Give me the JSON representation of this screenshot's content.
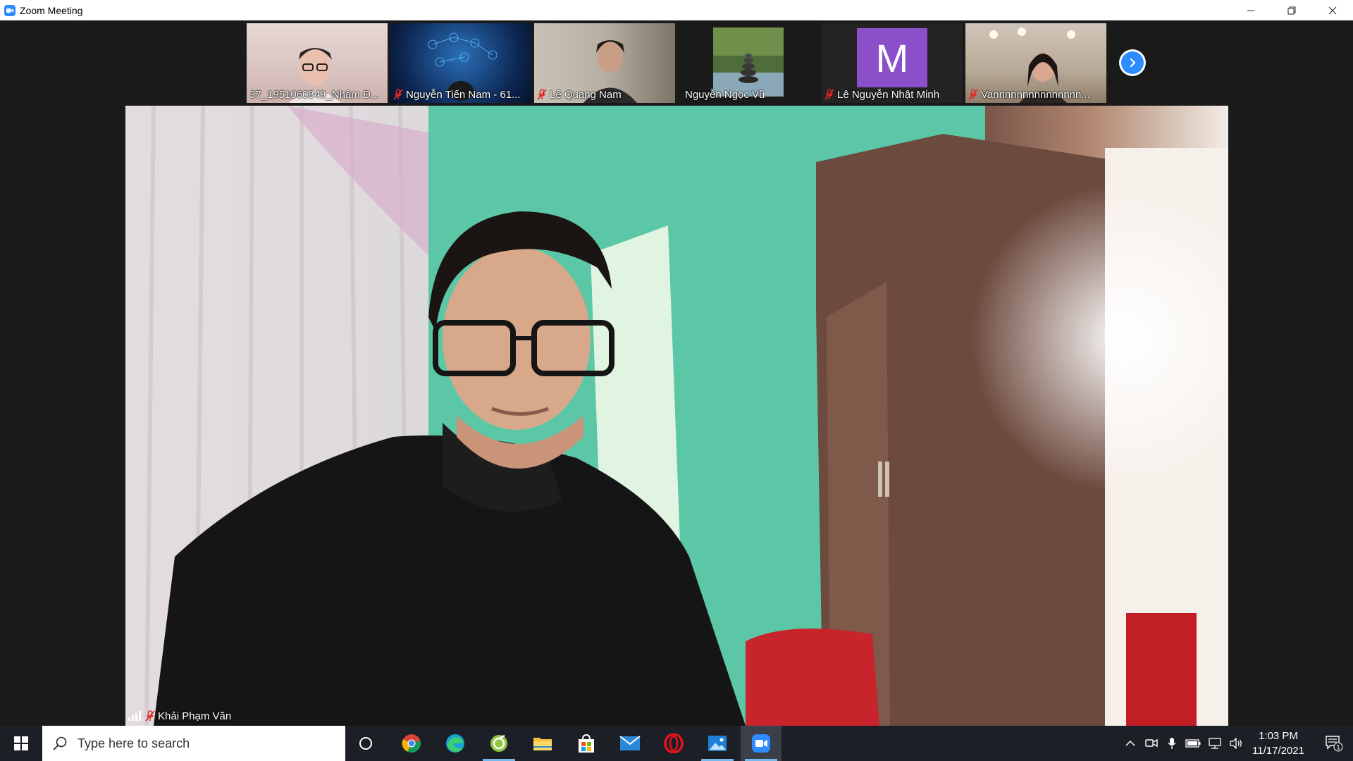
{
  "window": {
    "title": "Zoom Meeting",
    "controls": [
      "minimize-icon",
      "restore-icon",
      "close-icon"
    ]
  },
  "gallery": {
    "participants": [
      {
        "name": "37_1951060849_Nhâm Đ...",
        "muted": false,
        "icon": ""
      },
      {
        "name": "Nguyễn Tiến Nam - 61...",
        "muted": true
      },
      {
        "name": "Lê Quang Nam",
        "muted": true
      },
      {
        "name": "Nguyễn Ngọc Vũ",
        "muted": false
      },
      {
        "name": "Lê Nguyễn Nhật Minh",
        "muted": true,
        "avatar_letter": "M",
        "avatar_color": "#8b4fc9"
      },
      {
        "name": "Vannnnnnnnnnnnnnn...",
        "muted": true
      }
    ],
    "next_page_icon": "chevron-right-icon"
  },
  "main_video": {
    "speaker_name": "Khải Phạm Văn",
    "muted": true,
    "signal_icon": "signal-bars-icon"
  },
  "taskbar": {
    "search_placeholder": "Type here to search",
    "pinned": [
      "cortana-icon",
      "chrome-icon",
      "edge-icon",
      "greenshot-icon",
      "file-explorer-icon",
      "store-icon",
      "mail-icon",
      "opera-icon",
      "photos-icon",
      "zoom-icon"
    ],
    "tray": [
      "show-hidden-icon",
      "meet-now-icon",
      "microphone-icon",
      "battery-icon",
      "network-icon",
      "volume-icon"
    ],
    "time": "1:03 PM",
    "date": "11/17/2021",
    "notification_count": "1"
  },
  "colors": {
    "zoom_blue": "#2d8cff",
    "muted_red": "#e02828",
    "taskbar_bg": "#1c1f26"
  }
}
